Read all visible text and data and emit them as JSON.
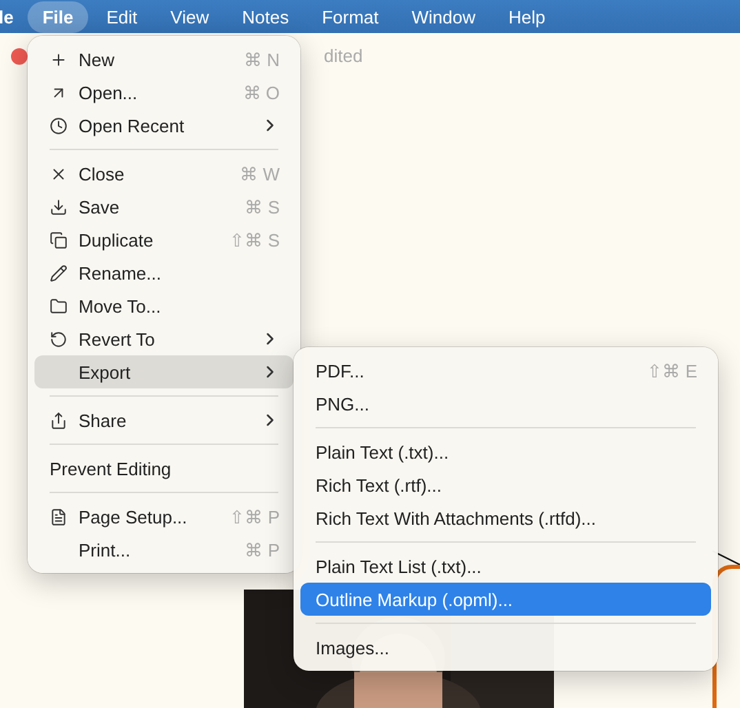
{
  "menubar": {
    "app_fragment": "le",
    "items": [
      {
        "label": "File",
        "selected": true
      },
      {
        "label": "Edit",
        "selected": false
      },
      {
        "label": "View",
        "selected": false
      },
      {
        "label": "Notes",
        "selected": false
      },
      {
        "label": "Format",
        "selected": false
      },
      {
        "label": "Window",
        "selected": false
      },
      {
        "label": "Help",
        "selected": false
      }
    ]
  },
  "window": {
    "title_fragment": "dited"
  },
  "file_menu": {
    "sections": [
      [
        {
          "label": "New",
          "shortcut": "⌘ N",
          "submenu": false,
          "selected": false
        },
        {
          "label": "Open...",
          "shortcut": "⌘ O",
          "submenu": false,
          "selected": false
        },
        {
          "label": "Open Recent",
          "submenu": true,
          "selected": false
        }
      ],
      [
        {
          "label": "Close",
          "shortcut": "⌘ W",
          "submenu": false,
          "selected": false
        },
        {
          "label": "Save",
          "shortcut": "⌘ S",
          "submenu": false,
          "selected": false
        },
        {
          "label": "Duplicate",
          "shortcut": "⇧⌘ S",
          "submenu": false,
          "selected": false
        },
        {
          "label": "Rename...",
          "submenu": false,
          "selected": false
        },
        {
          "label": "Move To...",
          "submenu": false,
          "selected": false
        },
        {
          "label": "Revert To",
          "submenu": true,
          "selected": false
        },
        {
          "label": "Export",
          "submenu": true,
          "selected": true
        }
      ],
      [
        {
          "label": "Share",
          "submenu": true,
          "selected": false
        }
      ],
      [
        {
          "label": "Prevent Editing",
          "submenu": false,
          "selected": false
        }
      ],
      [
        {
          "label": "Page Setup...",
          "shortcut": "⇧⌘ P",
          "submenu": false,
          "selected": false
        },
        {
          "label": "Print...",
          "shortcut": "⌘ P",
          "submenu": false,
          "selected": false
        }
      ]
    ]
  },
  "export_menu": {
    "sections": [
      [
        {
          "label": "PDF...",
          "shortcut": "⇧⌘ E",
          "selected": false
        },
        {
          "label": "PNG...",
          "selected": false
        }
      ],
      [
        {
          "label": "Plain Text (.txt)...",
          "selected": false
        },
        {
          "label": "Rich Text (.rtf)...",
          "selected": false
        },
        {
          "label": "Rich Text With Attachments (.rtfd)...",
          "selected": false
        }
      ],
      [
        {
          "label": "Plain Text List (.txt)...",
          "selected": false
        },
        {
          "label": "Outline Markup (.opml)...",
          "selected": true
        }
      ],
      [
        {
          "label": "Images...",
          "selected": false
        }
      ]
    ]
  }
}
